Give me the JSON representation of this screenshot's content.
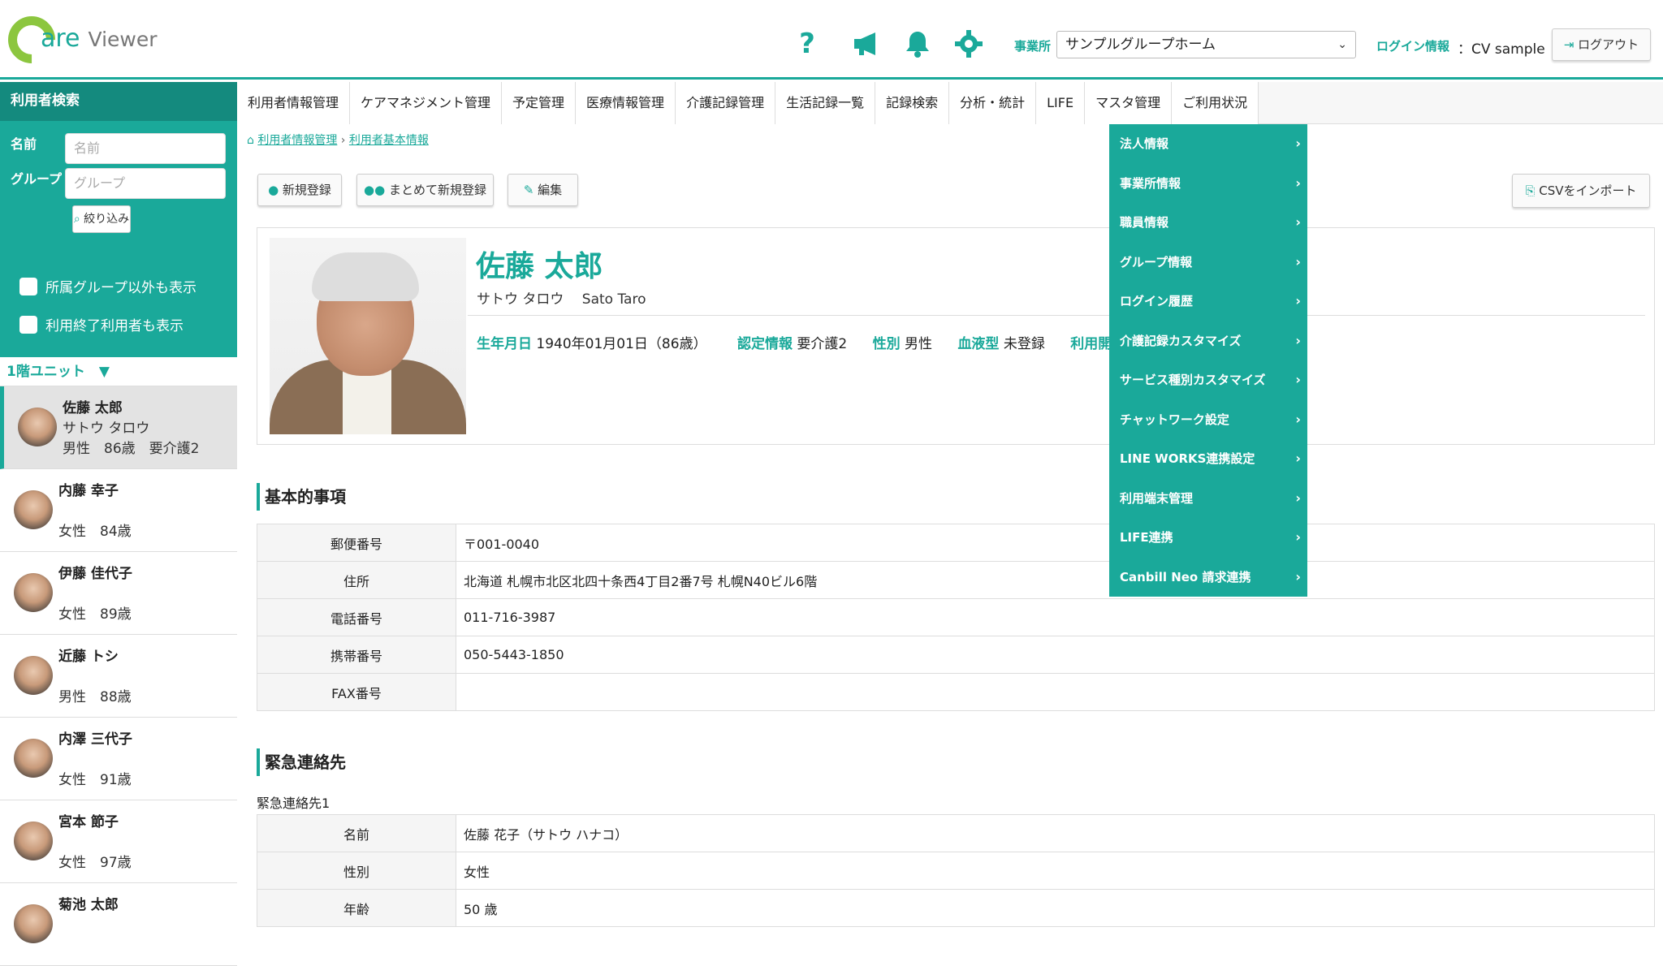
{
  "brand": {
    "logo_text": "are",
    "logo_viewer": "Viewer",
    "accent": "#1aa99a"
  },
  "header": {
    "icons": [
      "help-icon",
      "megaphone-icon",
      "bell-icon",
      "gear-icon"
    ],
    "office_label": "事業所",
    "office_value": "サンプルグループホーム",
    "login_label": "ログイン情報",
    "login_value": "：CV sample",
    "logout_label": "ログアウト"
  },
  "sidebar": {
    "title": "利用者検索",
    "name_label": "名前",
    "name_placeholder": "名前",
    "group_label": "グループ",
    "group_placeholder": "グループ",
    "filter_label": "絞り込み",
    "check1": "所属グループ以外も表示",
    "check2": "利用終了利用者も表示",
    "unit": "1階ユニット　▼",
    "people": [
      {
        "name": "佐藤 太郎",
        "kana": "サトウ タロウ",
        "info": "男性　86歳　要介護2"
      },
      {
        "name": "内藤 幸子",
        "kana": "",
        "info": "女性　84歳"
      },
      {
        "name": "伊藤 佳代子",
        "kana": "",
        "info": "女性　89歳"
      },
      {
        "name": "近藤 トシ",
        "kana": "",
        "info": "男性　88歳"
      },
      {
        "name": "内澤 三代子",
        "kana": "",
        "info": "女性　91歳"
      },
      {
        "name": "宮本 節子",
        "kana": "",
        "info": "女性　97歳"
      },
      {
        "name": "菊池 太郎",
        "kana": "",
        "info": ""
      }
    ]
  },
  "nav": [
    "利用者情報管理",
    "ケアマネジメント管理",
    "予定管理",
    "医療情報管理",
    "介護記録管理",
    "生活記録一覧",
    "記録検索",
    "分析・統計",
    "LIFE",
    "マスタ管理",
    "ご利用状況"
  ],
  "breadcrumb": {
    "home": "利用者情報管理",
    "sep": "›",
    "current": "利用者基本情報"
  },
  "actions": {
    "new": "新規登録",
    "bulk": "まとめて新規登録",
    "edit": "編集",
    "csv": "CSVをインポート"
  },
  "profile": {
    "name": "佐藤 太郎",
    "kana": "サトウ タロウ　 Sato Taro",
    "birth_label": "生年月日",
    "birth_value": "1940年01月01日（86歳）",
    "cert_label": "認定情報",
    "cert_value": "要介護2",
    "sex_label": "性別",
    "sex_value": "男性",
    "blood_label": "血液型",
    "blood_value": "未登録",
    "start_label": "利用開始年"
  },
  "basic": {
    "title": "基本的事項",
    "rows": [
      {
        "k": "郵便番号",
        "v": "〒001-0040"
      },
      {
        "k": "住所",
        "v": "北海道 札幌市北区北四十条西4丁目2番7号 札幌N40ビル6階"
      },
      {
        "k": "電話番号",
        "v": "011-716-3987"
      },
      {
        "k": "携帯番号",
        "v": "050-5443-1850"
      },
      {
        "k": "FAX番号",
        "v": ""
      }
    ]
  },
  "emergency": {
    "title": "緊急連絡先",
    "sub": "緊急連絡先1",
    "rows": [
      {
        "k": "名前",
        "v": "佐藤 花子（サトウ ハナコ）"
      },
      {
        "k": "性別",
        "v": "女性"
      },
      {
        "k": "年齢",
        "v": "50 歳"
      }
    ]
  },
  "master_menu": [
    "法人情報",
    "事業所情報",
    "職員情報",
    "グループ情報",
    "ログイン履歴",
    "介護記録カスタマイズ",
    "サービス種別カスタマイズ",
    "チャットワーク設定",
    "LINE WORKS連携設定",
    "利用端末管理",
    "LIFE連携",
    "Canbill Neo 請求連携"
  ]
}
